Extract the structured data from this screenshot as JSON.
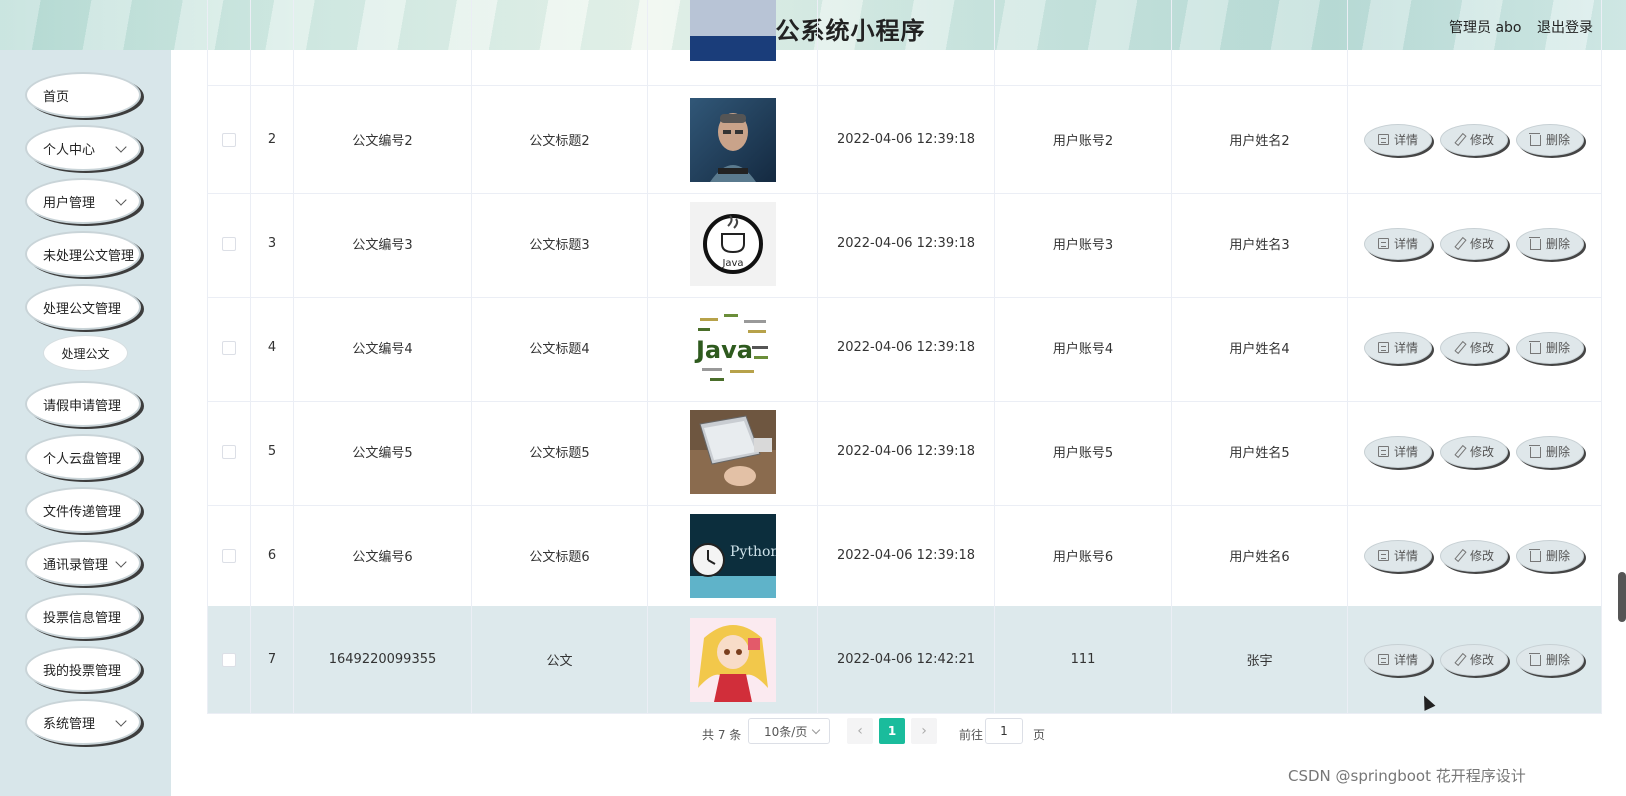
{
  "header": {
    "title": "协同办公系统小程序",
    "user": "管理员 abo",
    "logout": "退出登录"
  },
  "sidebar": {
    "items": [
      {
        "label": "首页",
        "has_arrow": false
      },
      {
        "label": "个人中心",
        "has_arrow": true
      },
      {
        "label": "用户管理",
        "has_arrow": true
      },
      {
        "label": "未处理公文管理",
        "has_arrow": false
      },
      {
        "label": "处理公文管理",
        "has_arrow": false
      },
      {
        "label": "请假申请管理",
        "has_arrow": false
      },
      {
        "label": "个人云盘管理",
        "has_arrow": false
      },
      {
        "label": "文件传递管理",
        "has_arrow": false
      },
      {
        "label": "通讯录管理",
        "has_arrow": true
      },
      {
        "label": "投票信息管理",
        "has_arrow": false
      },
      {
        "label": "我的投票管理",
        "has_arrow": false
      },
      {
        "label": "系统管理",
        "has_arrow": true
      }
    ],
    "sub_item": "处理公文"
  },
  "table": {
    "rows": [
      {
        "index": "2",
        "doc_no": "公文编号2",
        "doc_title": "公文标题2",
        "image": "photo-man-portrait",
        "time": "2022-04-06 12:39:18",
        "account": "用户账号2",
        "name": "用户姓名2"
      },
      {
        "index": "3",
        "doc_no": "公文编号3",
        "doc_title": "公文标题3",
        "image": "java-logo",
        "time": "2022-04-06 12:39:18",
        "account": "用户账号3",
        "name": "用户姓名3"
      },
      {
        "index": "4",
        "doc_no": "公文编号4",
        "doc_title": "公文标题4",
        "image": "java-word-cloud",
        "time": "2022-04-06 12:39:18",
        "account": "用户账号4",
        "name": "用户姓名4"
      },
      {
        "index": "5",
        "doc_no": "公文编号5",
        "doc_title": "公文标题5",
        "image": "laptop-typing-photo",
        "time": "2022-04-06 12:39:18",
        "account": "用户账号5",
        "name": "用户姓名5"
      },
      {
        "index": "6",
        "doc_no": "公文编号6",
        "doc_title": "公文标题6",
        "image": "python-clock-image",
        "time": "2022-04-06 12:39:18",
        "account": "用户账号6",
        "name": "用户姓名6"
      },
      {
        "index": "7",
        "doc_no": "1649220099355",
        "doc_title": "公文",
        "image": "anime-girl-image",
        "time": "2022-04-06 12:42:21",
        "account": "111",
        "name": "张宇"
      }
    ],
    "highlighted_row": 5,
    "python_text": "Python",
    "java_text": "Java",
    "actions": {
      "detail": "详情",
      "edit": "修改",
      "delete": "删除"
    }
  },
  "pagination": {
    "total": "共 7 条",
    "page_size": "10条/页",
    "current": "1",
    "goto_label": "前往",
    "goto_value": "1",
    "page_suffix": "页",
    "prev": "‹",
    "next": "›"
  },
  "watermark": "CSDN @springboot 花开程序设计",
  "colors": {
    "accent": "#1abc9c",
    "sidebar_bg": "#d8e6ea",
    "highlight_row": "#dde9ec"
  }
}
